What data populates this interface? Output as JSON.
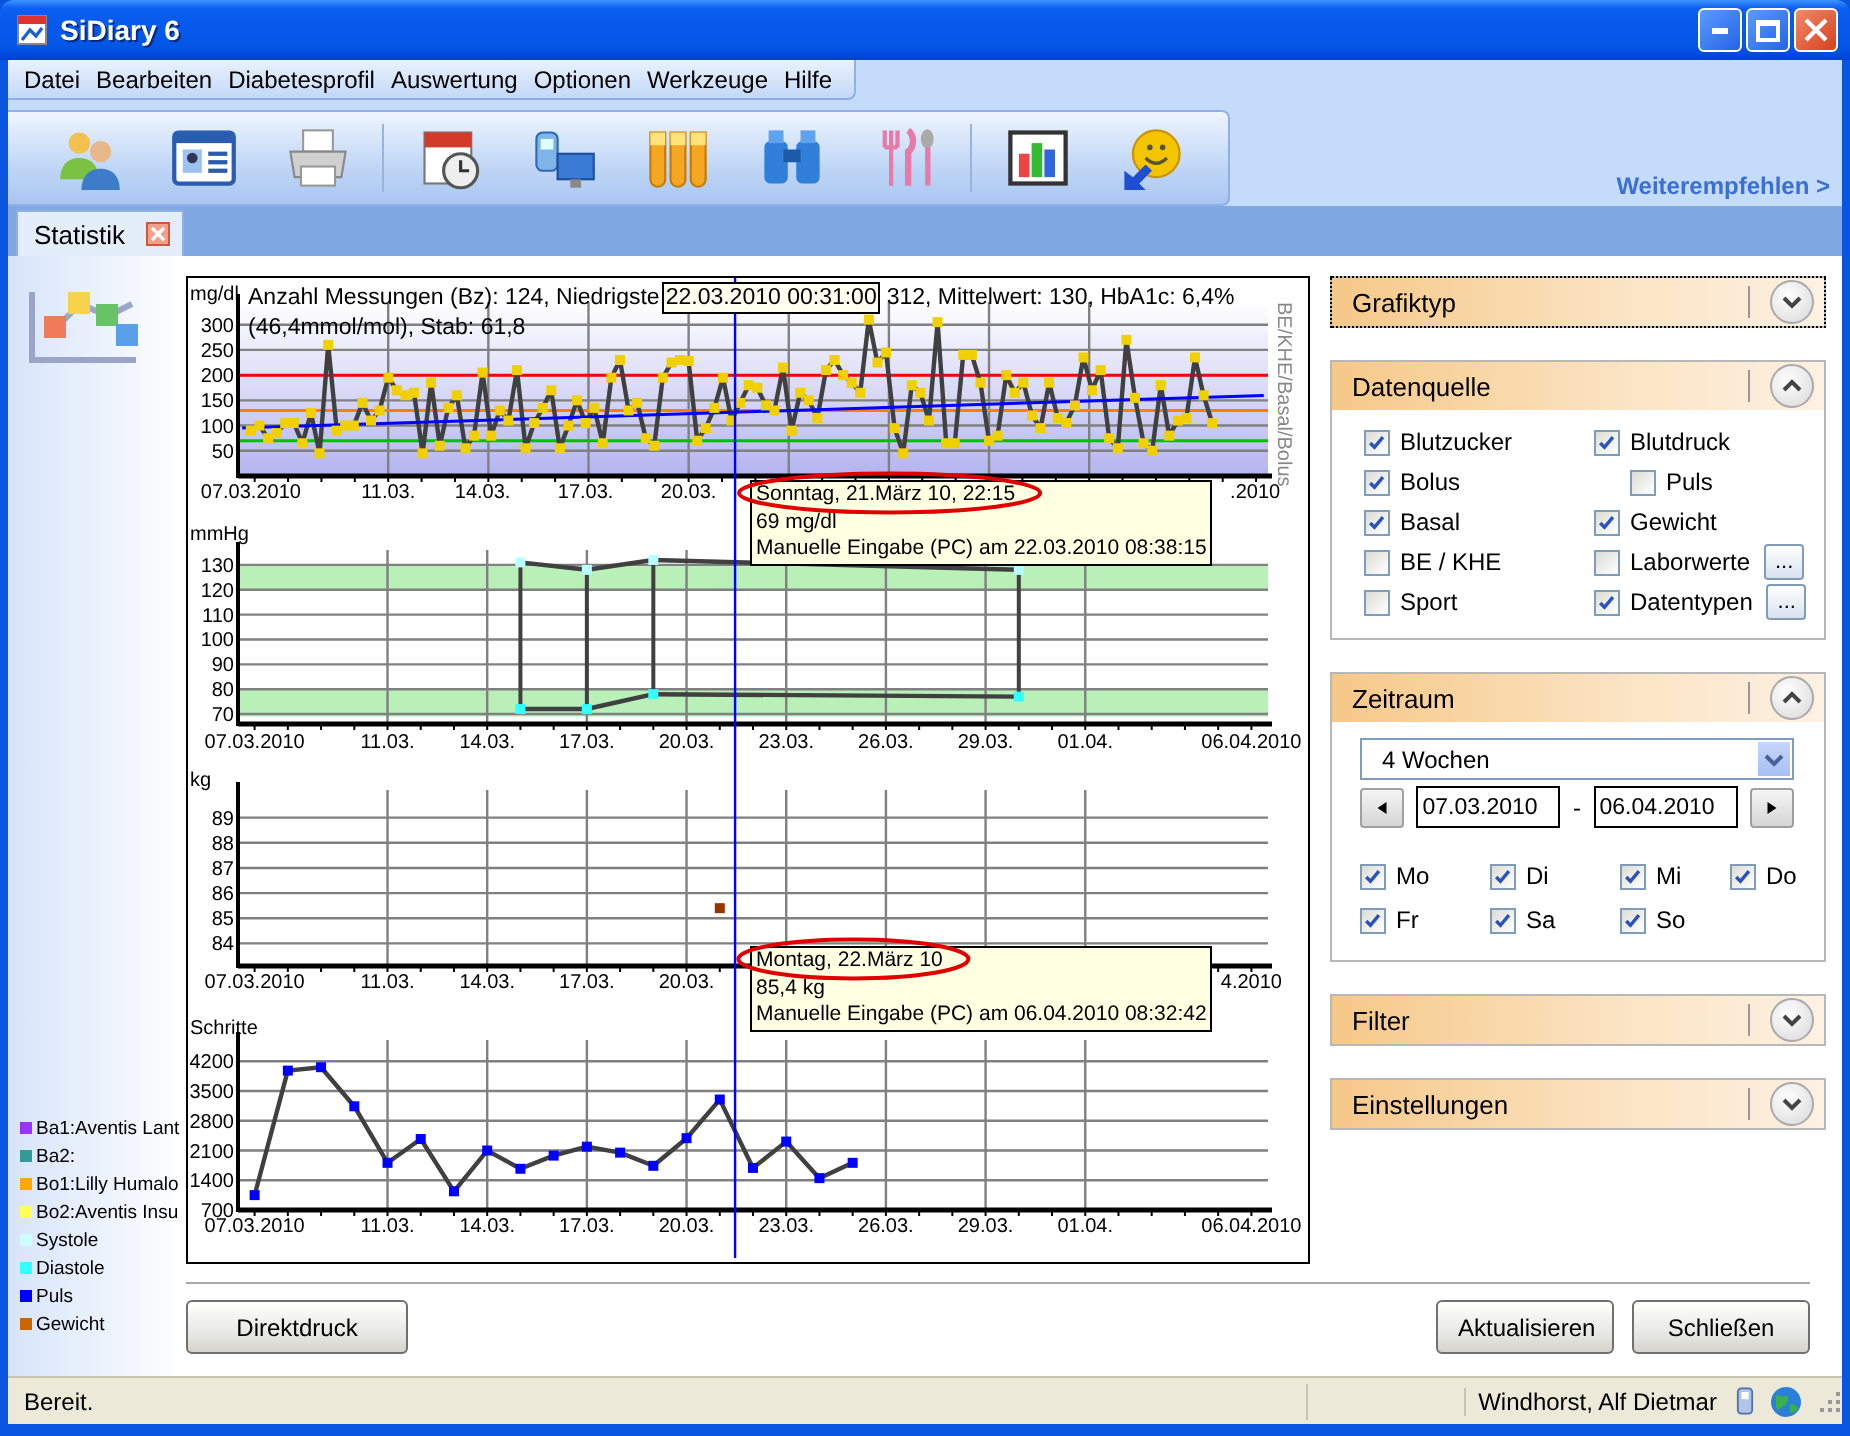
{
  "window": {
    "title": "SiDiary 6"
  },
  "menu": [
    "Datei",
    "Bearbeiten",
    "Diabetesprofil",
    "Auswertung",
    "Optionen",
    "Werkzeuge",
    "Hilfe"
  ],
  "toolbar": [
    {
      "kind": "people"
    },
    {
      "kind": "id-card"
    },
    {
      "kind": "printer"
    },
    {
      "kind": "separator"
    },
    {
      "kind": "calendar"
    },
    {
      "kind": "devices"
    },
    {
      "kind": "test-tubes"
    },
    {
      "kind": "binoculars"
    },
    {
      "kind": "cutlery"
    },
    {
      "kind": "separator"
    },
    {
      "kind": "chart"
    },
    {
      "kind": "smiley"
    }
  ],
  "recommend_link": "Weiterempfehlen >",
  "tabs": [
    {
      "label": "Statistik",
      "selected": true
    }
  ],
  "legend": [
    {
      "label": "Ba1:Aventis Lant",
      "color": "#9933ff"
    },
    {
      "label": "Ba2:",
      "color": "#339999"
    },
    {
      "label": "Bo1:Lilly Humalo",
      "color": "#ffaa00"
    },
    {
      "label": "Bo2:Aventis Insu",
      "color": "#ffff55"
    },
    {
      "label": "Systole",
      "color": "#ccffff"
    },
    {
      "label": "Diastole",
      "color": "#33ffff"
    },
    {
      "label": "Puls",
      "color": "#0000ff"
    },
    {
      "label": "Gewicht",
      "color": "#cc6600"
    }
  ],
  "charts": [
    {
      "summary": {
        "text_before": "Anzahl Messungen (Bz): 124, Niedrigste",
        "cursor_time": "22.03.2010 00:31:00",
        "text_after": "312, Mittelwert: 130, HbA1c: 6,4%",
        "line2": "(46,4mmol/mol), Stab: 61,8"
      },
      "tooltip": {
        "lines": [
          "Sonntag, 21.März 10, 22:15",
          "69 mg/dl",
          "Manuelle Eingabe (PC) am 22.03.2010 08:38:15"
        ],
        "highlighted": true
      },
      "chart_data": {
        "type": "line",
        "ylabel": "mg/dl",
        "y2label": "BE/KHE/Basal/Bolus",
        "grid": true,
        "ylim": [
          0,
          345
        ],
        "yticks": [
          50,
          100,
          150,
          200,
          250,
          300
        ],
        "categories": [
          null,
          "07.03.2010",
          null,
          null,
          null,
          null,
          null,
          null,
          null,
          null,
          null,
          null,
          null,
          null,
          null,
          null,
          null,
          "11.03.",
          null,
          null,
          null,
          null,
          null,
          null,
          null,
          null,
          null,
          null,
          "14.03.",
          null,
          null,
          null,
          null,
          null,
          null,
          null,
          null,
          null,
          null,
          null,
          "17.03.",
          null,
          null,
          null,
          null,
          null,
          null,
          null,
          null,
          null,
          null,
          null,
          "20.03.",
          null,
          null,
          null,
          null,
          null,
          null,
          null,
          null,
          null,
          null,
          null,
          null,
          null,
          null,
          null,
          null,
          null,
          null,
          null,
          null,
          null,
          null,
          null,
          null,
          null,
          null,
          null,
          null,
          null,
          null,
          null,
          null,
          null,
          null,
          null,
          null,
          null,
          null,
          null,
          null,
          null,
          null,
          null,
          null,
          null,
          null,
          null,
          null,
          null,
          null,
          null,
          null,
          null,
          null,
          null,
          null,
          null,
          null,
          null,
          null,
          null,
          null,
          null,
          null,
          null,
          ".2010",
          null
        ],
        "series": [
          {
            "color": "#f0d000",
            "marker": "s",
            "values": [
              null,
              90,
              100,
              75,
              85,
              105,
              105,
              65,
              125,
              45,
              260,
              90,
              100,
              100,
              145,
              110,
              130,
              195,
              170,
              160,
              165,
              45,
              185,
              60,
              135,
              160,
              55,
              80,
              205,
              80,
              130,
              110,
              210,
              55,
              105,
              135,
              170,
              55,
              100,
              150,
              105,
              135,
              65,
              195,
              230,
              130,
              145,
              75,
              60,
              195,
              225,
              230,
              228,
              70,
              95,
              135,
              195,
              110,
              145,
              180,
              175,
              140,
              130,
              215,
              90,
              165,
              150,
              115,
              210,
              230,
              200,
              185,
              165,
              310,
              225,
              245,
              95,
              45,
              180,
              165,
              110,
              305,
              65,
              65,
              240,
              240,
              185,
              70,
              80,
              200,
              165,
              185,
              120,
              95,
              185,
              115,
              105,
              140,
              235,
              170,
              210,
              75,
              55,
              270,
              155,
              65,
              50,
              180,
              80,
              110,
              115,
              235,
              160,
              105,
              null,
              null,
              null,
              null,
              null,
              null
            ]
          },
          {
            "color": "#0000ff",
            "values": [
              95,
              null,
              null,
              null,
              null,
              null,
              null,
              null,
              null,
              null,
              null,
              null,
              null,
              null,
              null,
              null,
              null,
              null,
              null,
              null,
              null,
              null,
              null,
              null,
              null,
              null,
              null,
              null,
              null,
              null,
              null,
              null,
              null,
              null,
              null,
              null,
              null,
              null,
              null,
              null,
              null,
              null,
              null,
              null,
              null,
              null,
              null,
              null,
              null,
              null,
              null,
              null,
              null,
              null,
              null,
              null,
              null,
              null,
              null,
              null,
              null,
              null,
              null,
              null,
              null,
              null,
              null,
              null,
              null,
              null,
              null,
              null,
              null,
              null,
              null,
              null,
              null,
              null,
              null,
              null,
              null,
              null,
              null,
              null,
              null,
              null,
              null,
              null,
              null,
              null,
              null,
              null,
              null,
              null,
              null,
              null,
              null,
              null,
              null,
              null,
              null,
              null,
              null,
              null,
              null,
              null,
              null,
              null,
              null,
              null,
              null,
              null,
              null,
              null,
              null,
              null,
              null,
              null,
              null,
              160
            ]
          }
        ],
        "ref_lines": [
          {
            "axis": "y",
            "value": 200,
            "color": "#ff0000"
          },
          {
            "axis": "y",
            "value": 130,
            "color": "#ff8000"
          },
          {
            "axis": "y",
            "value": 70,
            "color": "#00c000"
          }
        ]
      }
    },
    {
      "chart_data": {
        "type": "line",
        "ylabel": "mmHg",
        "grid": true,
        "ylim": [
          66,
          136
        ],
        "yticks": [
          70,
          80,
          90,
          100,
          110,
          120,
          130
        ],
        "categories": [
          "07.03.2010",
          null,
          null,
          null,
          "11.03.",
          null,
          null,
          "14.03.",
          null,
          null,
          "17.03.",
          null,
          null,
          "20.03.",
          null,
          null,
          "23.03.",
          null,
          null,
          "26.03.",
          null,
          null,
          "29.03.",
          null,
          null,
          "01.04.",
          null,
          null,
          null,
          null,
          "06.04.2010"
        ],
        "series": [
          {
            "color": "#b8ffff",
            "marker": "s",
            "values": [
              null,
              null,
              null,
              null,
              null,
              null,
              null,
              null,
              131,
              null,
              128,
              null,
              132,
              null,
              null,
              null,
              null,
              null,
              null,
              null,
              null,
              null,
              null,
              128,
              null,
              null,
              null,
              null,
              null,
              null,
              null
            ]
          },
          {
            "color": "#33ffff",
            "marker": "s",
            "values": [
              null,
              null,
              null,
              null,
              null,
              null,
              null,
              null,
              72,
              null,
              72,
              null,
              78,
              null,
              null,
              null,
              null,
              null,
              null,
              null,
              null,
              null,
              null,
              77,
              null,
              null,
              null,
              null,
              null,
              null,
              null
            ]
          }
        ],
        "bands": [
          {
            "axis": "y",
            "from": 120,
            "to": 130,
            "color": "#b8f0b8"
          },
          {
            "axis": "y",
            "from": 69,
            "to": 80,
            "color": "#b8f0b8"
          }
        ]
      }
    },
    {
      "tooltip": {
        "lines": [
          "Montag, 22.März 10",
          "85,4 kg",
          "Manuelle Eingabe (PC) am 06.04.2010 08:32:42"
        ],
        "highlighted": true
      },
      "chart_data": {
        "type": "line",
        "ylabel": "kg",
        "grid": true,
        "ylim": [
          83.1,
          90.1
        ],
        "yticks": [
          84,
          85,
          86,
          87,
          88,
          89
        ],
        "categories": [
          "07.03.2010",
          null,
          null,
          null,
          "11.03.",
          null,
          null,
          "14.03.",
          null,
          null,
          "17.03.",
          null,
          null,
          "20.03.",
          null,
          null,
          null,
          null,
          null,
          null,
          null,
          null,
          null,
          null,
          null,
          null,
          null,
          null,
          null,
          null,
          "4.2010"
        ],
        "series": [
          {
            "color": "#993300",
            "marker": "s",
            "values": [
              null,
              null,
              null,
              null,
              null,
              null,
              null,
              null,
              null,
              null,
              null,
              null,
              null,
              null,
              85.4,
              null,
              null,
              null,
              null,
              null,
              null,
              null,
              null,
              null,
              null,
              null,
              null,
              null,
              null,
              null,
              null
            ]
          }
        ]
      }
    },
    {
      "chart_data": {
        "type": "line",
        "ylabel": "Schritte",
        "grid": true,
        "ylim": [
          700,
          4700
        ],
        "yticks": [
          700,
          1400,
          2100,
          2800,
          3500,
          4200
        ],
        "categories": [
          "07.03.2010",
          null,
          null,
          null,
          "11.03.",
          null,
          null,
          "14.03.",
          null,
          null,
          "17.03.",
          null,
          null,
          "20.03.",
          null,
          null,
          "23.03.",
          null,
          null,
          "26.03.",
          null,
          null,
          "29.03.",
          null,
          null,
          "01.04.",
          null,
          null,
          null,
          null,
          "06.04.2010"
        ],
        "series": [
          {
            "color": "#0000ff",
            "marker": "s",
            "values": [
              1050,
              3980,
              4060,
              3140,
              1810,
              2370,
              1140,
              2100,
              1670,
              1980,
              2190,
              2050,
              1740,
              2390,
              3300,
              1690,
              2310,
              1450,
              1810,
              null,
              null,
              null,
              null,
              null,
              null,
              null,
              null,
              null,
              null,
              null,
              null
            ]
          }
        ]
      }
    }
  ],
  "right_panel": {
    "sections": [
      {
        "title": "Grafiktyp",
        "expanded": false,
        "focused": true
      },
      {
        "title": "Datenquelle",
        "expanded": true,
        "focused": false,
        "kind": "sources",
        "columns": [
          [
            {
              "label": "Blutzucker",
              "checked": true
            },
            {
              "label": "Bolus",
              "checked": true
            },
            {
              "label": "Basal",
              "checked": true
            },
            {
              "label": "BE / KHE",
              "checked": false
            },
            {
              "label": "Sport",
              "checked": false
            }
          ],
          [
            {
              "label": "Blutdruck",
              "checked": true,
              "children": [
                {
                  "label": "Puls",
                  "checked": false
                }
              ]
            },
            {
              "label": "Gewicht",
              "checked": true
            },
            {
              "label": "Laborwerte",
              "checked": false,
              "button": "..."
            },
            {
              "label": "Datentypen",
              "checked": true,
              "button": "..."
            }
          ]
        ]
      },
      {
        "title": "Zeitraum",
        "expanded": true,
        "focused": false,
        "kind": "period",
        "range": {
          "value": "4 Wochen"
        },
        "from": "07.03.2010",
        "dash": "-",
        "to": "06.04.2010",
        "weekdays": [
          {
            "label": "Mo",
            "checked": true
          },
          {
            "label": "Di",
            "checked": true
          },
          {
            "label": "Mi",
            "checked": true
          },
          {
            "label": "Do",
            "checked": true
          },
          {
            "label": "Fr",
            "checked": true
          },
          {
            "label": "Sa",
            "checked": true
          },
          {
            "label": "So",
            "checked": true
          }
        ]
      },
      {
        "title": "Filter",
        "expanded": false,
        "focused": false
      },
      {
        "title": "Einstellungen",
        "expanded": false,
        "focused": false
      }
    ]
  },
  "left_buttons": [
    "Direktdruck"
  ],
  "right_buttons": [
    "Aktualisieren",
    "Schließen"
  ],
  "status_bar": {
    "message": "Bereit.",
    "user": "Windhorst, Alf Dietmar"
  }
}
